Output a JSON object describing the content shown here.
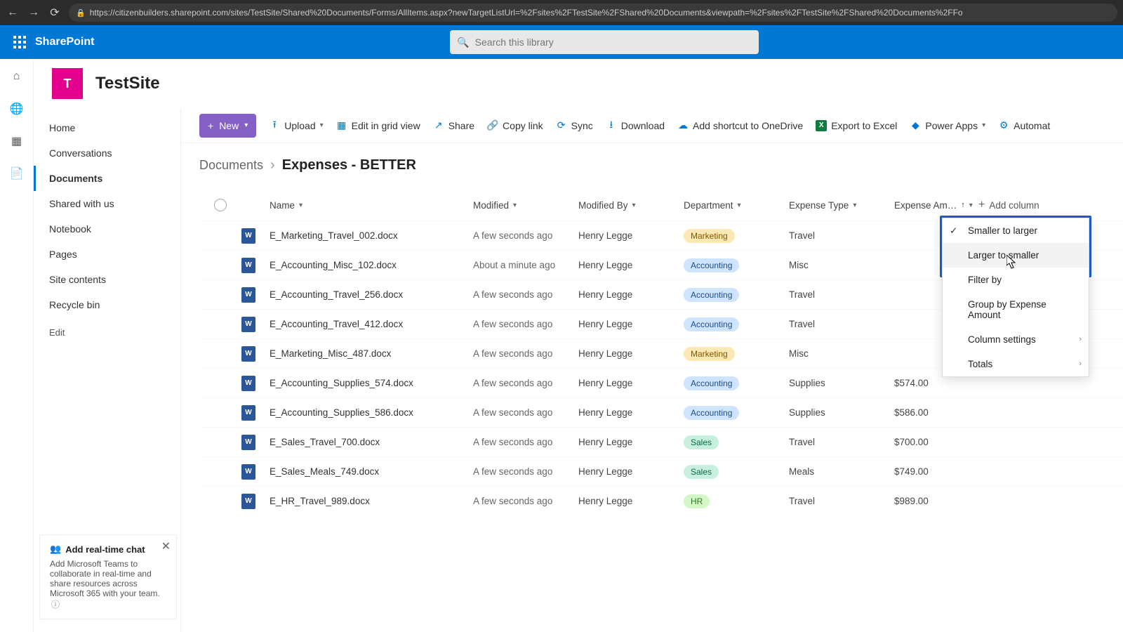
{
  "browser": {
    "url": "https://citizenbuilders.sharepoint.com/sites/TestSite/Shared%20Documents/Forms/AllItems.aspx?newTargetListUrl=%2Fsites%2FTestSite%2FShared%20Documents&viewpath=%2Fsites%2FTestSite%2FShared%20Documents%2FFo"
  },
  "brand": "SharePoint",
  "search": {
    "placeholder": "Search this library"
  },
  "site": {
    "initial": "T",
    "name": "TestSite"
  },
  "nav": {
    "home": "Home",
    "conversations": "Conversations",
    "documents": "Documents",
    "shared": "Shared with us",
    "notebook": "Notebook",
    "pages": "Pages",
    "contents": "Site contents",
    "recycle": "Recycle bin",
    "edit": "Edit"
  },
  "promo": {
    "title": "Add real-time chat",
    "body": "Add Microsoft Teams to collaborate in real-time and share resources across Microsoft 365 with your team."
  },
  "cmd": {
    "new": "New",
    "upload": "Upload",
    "editgrid": "Edit in grid view",
    "share": "Share",
    "copylink": "Copy link",
    "sync": "Sync",
    "download": "Download",
    "shortcut": "Add shortcut to OneDrive",
    "export": "Export to Excel",
    "powerapps": "Power Apps",
    "automate": "Automat"
  },
  "breadcrumb": {
    "root": "Documents",
    "leaf": "Expenses - BETTER"
  },
  "cols": {
    "name": "Name",
    "modified": "Modified",
    "modby": "Modified By",
    "dept": "Department",
    "etype": "Expense Type",
    "amt": "Expense Am…",
    "add": "Add column"
  },
  "rows": [
    {
      "name": "E_Marketing_Travel_002.docx",
      "mod": "A few seconds ago",
      "by": "Henry Legge",
      "dept": "Marketing",
      "deptclass": "marketing",
      "etype": "Travel",
      "amt": ""
    },
    {
      "name": "E_Accounting_Misc_102.docx",
      "mod": "About a minute ago",
      "by": "Henry Legge",
      "dept": "Accounting",
      "deptclass": "accounting",
      "etype": "Misc",
      "amt": ""
    },
    {
      "name": "E_Accounting_Travel_256.docx",
      "mod": "A few seconds ago",
      "by": "Henry Legge",
      "dept": "Accounting",
      "deptclass": "accounting",
      "etype": "Travel",
      "amt": ""
    },
    {
      "name": "E_Accounting_Travel_412.docx",
      "mod": "A few seconds ago",
      "by": "Henry Legge",
      "dept": "Accounting",
      "deptclass": "accounting",
      "etype": "Travel",
      "amt": ""
    },
    {
      "name": "E_Marketing_Misc_487.docx",
      "mod": "A few seconds ago",
      "by": "Henry Legge",
      "dept": "Marketing",
      "deptclass": "marketing",
      "etype": "Misc",
      "amt": ""
    },
    {
      "name": "E_Accounting_Supplies_574.docx",
      "mod": "A few seconds ago",
      "by": "Henry Legge",
      "dept": "Accounting",
      "deptclass": "accounting",
      "etype": "Supplies",
      "amt": "$574.00"
    },
    {
      "name": "E_Accounting_Supplies_586.docx",
      "mod": "A few seconds ago",
      "by": "Henry Legge",
      "dept": "Accounting",
      "deptclass": "accounting",
      "etype": "Supplies",
      "amt": "$586.00"
    },
    {
      "name": "E_Sales_Travel_700.docx",
      "mod": "A few seconds ago",
      "by": "Henry Legge",
      "dept": "Sales",
      "deptclass": "sales",
      "etype": "Travel",
      "amt": "$700.00"
    },
    {
      "name": "E_Sales_Meals_749.docx",
      "mod": "A few seconds ago",
      "by": "Henry Legge",
      "dept": "Sales",
      "deptclass": "sales",
      "etype": "Meals",
      "amt": "$749.00"
    },
    {
      "name": "E_HR_Travel_989.docx",
      "mod": "A few seconds ago",
      "by": "Henry Legge",
      "dept": "HR",
      "deptclass": "hr",
      "etype": "Travel",
      "amt": "$989.00"
    }
  ],
  "menu": {
    "smaller": "Smaller to larger",
    "larger": "Larger to smaller",
    "filter": "Filter by",
    "group": "Group by Expense Amount",
    "settings": "Column settings",
    "totals": "Totals"
  }
}
